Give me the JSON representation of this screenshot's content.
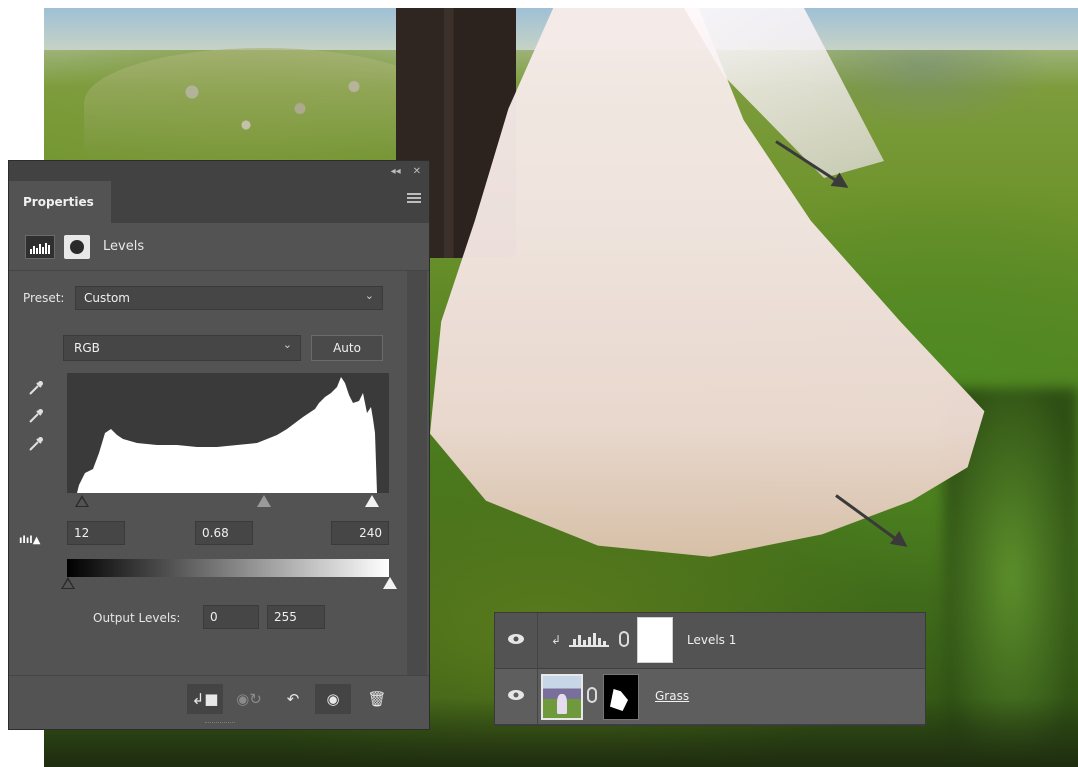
{
  "properties_panel": {
    "tab": "Properties",
    "adjustment_title": "Levels",
    "preset_label": "Preset:",
    "preset_value": "Custom",
    "channel": "RGB",
    "auto_label": "Auto",
    "input_levels": {
      "black": "12",
      "gamma": "0.68",
      "white": "240"
    },
    "output_label": "Output Levels:",
    "output_levels": {
      "black": "0",
      "white": "255"
    },
    "icons": [
      "histogram-icon",
      "mask-icon",
      "eyedropper-black-icon",
      "eyedropper-gray-icon",
      "eyedropper-white-icon",
      "clip-warning-icon",
      "clip-to-layer-icon",
      "view-previous-icon",
      "reset-icon",
      "visibility-icon",
      "delete-icon"
    ]
  },
  "layers_panel": {
    "layers": [
      {
        "name": "Levels 1",
        "visible": true,
        "type": "adjustment"
      },
      {
        "name": "Grass",
        "visible": true,
        "type": "pixel"
      }
    ]
  }
}
